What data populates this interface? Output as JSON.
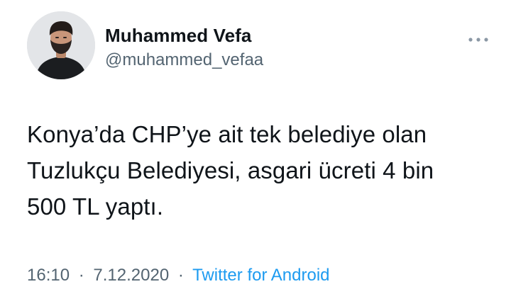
{
  "author": {
    "display_name": "Muhammed Vefa",
    "handle": "@muhammed_vefaa"
  },
  "tweet": {
    "text": "Konya’da CHP’ye ait tek belediye olan\nTuzlukçu Belediyesi, asgari ücreti 4 bin\n500 TL yaptı.",
    "time": "16:10",
    "date": "7.12.2020",
    "separator": "·",
    "source": "Twitter for Android"
  },
  "icons": {
    "more": "more-options-icon",
    "avatar": "avatar-photo"
  },
  "colors": {
    "text": "#0f1419",
    "secondary": "#536471",
    "link": "#1d9bf0",
    "background": "#ffffff"
  }
}
